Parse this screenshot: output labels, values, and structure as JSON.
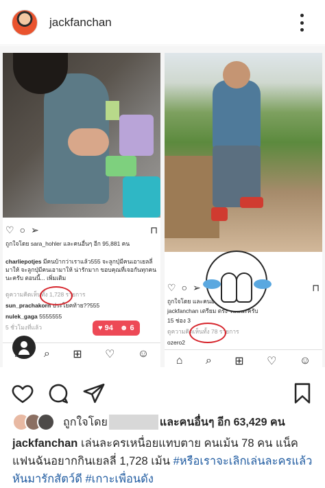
{
  "header": {
    "username": "jackfanchan"
  },
  "post_image": {
    "left_shot": {
      "liked_by": "ถูกใจโดย sara_hohler และคนอื่นๆ อีก 95,881 คน",
      "comments": [
        {
          "user": "charliepotjes",
          "text": "มีคนบ้ากว่าเราแล้ว555 จะลูกปุ่มีคนเอาเยลลี่มาให้ จะลูกปุ่มีคนเอามาให้ น่ารักมาก ขอบคุณที่เจอกันทุกคนนะครับ ตอนนี้... เพิ่มเติม"
        },
        {
          "user": "",
          "text": "ดูความคิดเห็นทั้ง 1,728 รายการ"
        },
        {
          "user": "sun_prachakorn",
          "text": "ประโยคท้าย??555"
        },
        {
          "user": "nulek_gaga",
          "text": "5555555"
        }
      ],
      "time": "5 ชั่วโมงที่แล้ว",
      "notif_likes": "94",
      "notif_follows": "6"
    },
    "right_shot": {
      "liked_by": "ถูกใจโดย และคนอื่นๆ อีก 8,614 คน",
      "caption": "jackfanchan เตรียม ตรง วันนี้นะครับ",
      "episodes": "15 ช่อง 3",
      "comment_count": "ดูความคิดเห็นทั้ง 78 รายการ",
      "commenter": "ozero2"
    }
  },
  "likes": {
    "prefix": "ถูกใจโดย",
    "rest": "และคนอื่นๆ อีก 63,429 คน"
  },
  "caption": {
    "username": "jackfanchan",
    "text": " เล่นละครเหนื่อยแทบตาย คนเม้น 78 คน แน็คแฟนฉันอยากกินเยลลี่ 1,728 เม้น ",
    "hashtags": "#หรือเราจะเลิกเล่นละครแล้วหันมารักสัตว์ดี #เกาะเพื่อนดัง"
  },
  "colors": {
    "accent_red": "#d6242b",
    "hashtag_blue": "#1e5aa0",
    "notif_red": "#ed4956"
  },
  "icons": [
    "more-icon",
    "heart-icon",
    "comment-icon",
    "share-icon",
    "bookmark-icon"
  ]
}
